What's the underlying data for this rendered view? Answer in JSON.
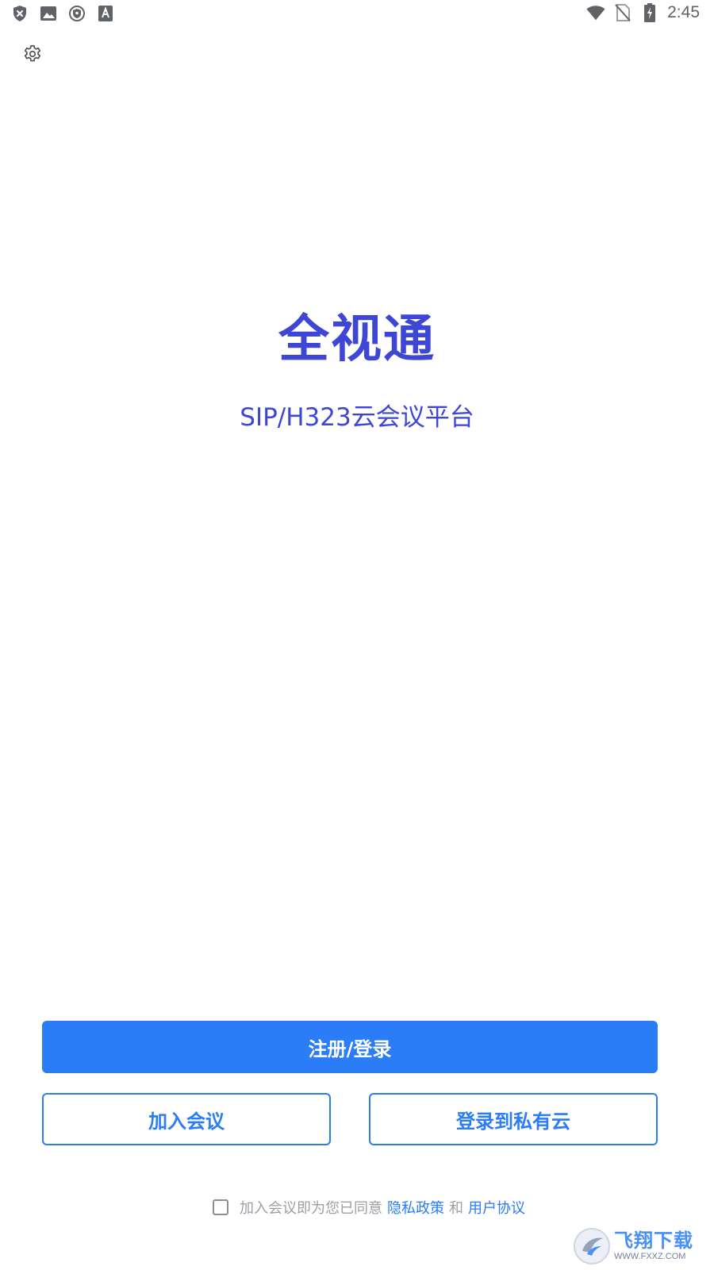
{
  "status_bar": {
    "time": "2:45",
    "left_icons": [
      "shield-x-icon",
      "image-icon",
      "vpn-shield-icon",
      "font-a-icon"
    ],
    "right_icons": [
      "wifi-icon",
      "no-sim-icon",
      "battery-charging-icon"
    ]
  },
  "header": {
    "settings_icon": "gear-icon"
  },
  "main": {
    "title": "全视通",
    "subtitle": "SIP/H323云会议平台",
    "title_color": "#3e46d6"
  },
  "actions": {
    "primary_label": "注册/登录",
    "join_label": "加入会议",
    "private_cloud_label": "登录到私有云",
    "accent_color": "#2a7cf7"
  },
  "agreement": {
    "checked": false,
    "prefix": "加入会议即为您已同意",
    "privacy_link": "隐私政策",
    "and": "和",
    "terms_link": "用户协议"
  },
  "watermark": {
    "cn": "飞翔下载",
    "en": "WWW.FXXZ.COM"
  }
}
